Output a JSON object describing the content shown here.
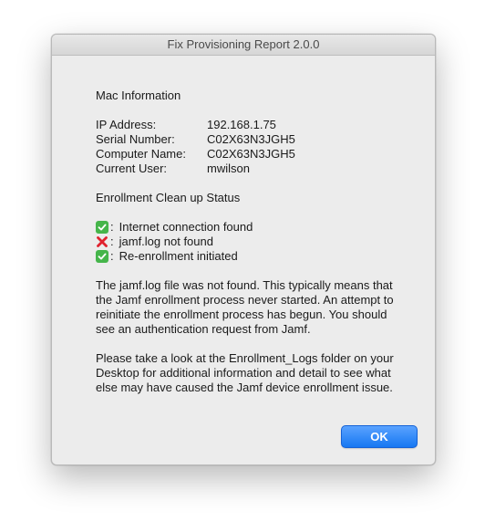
{
  "window": {
    "title": "Fix Provisioning Report 2.0.0"
  },
  "mac_info": {
    "heading": "Mac Information",
    "rows": [
      {
        "label": "IP Address:",
        "value": "192.168.1.75"
      },
      {
        "label": "Serial Number:",
        "value": "C02X63N3JGH5"
      },
      {
        "label": "Computer Name:",
        "value": "C02X63N3JGH5"
      },
      {
        "label": "Current User:",
        "value": "mwilson"
      }
    ]
  },
  "status": {
    "heading": "Enrollment Clean up Status",
    "items": [
      {
        "icon": "check-icon",
        "text": "Internet connection found"
      },
      {
        "icon": "cross-icon",
        "text": "jamf.log not found"
      },
      {
        "icon": "check-icon",
        "text": "Re-enrollment initiated"
      }
    ],
    "separator": ":"
  },
  "messages": {
    "p1": "The jamf.log file was not found. This typically means that the Jamf enrollment process never started. An attempt to reinitiate the enrollment process has begun. You should see an authentication request from Jamf.",
    "p2": "Please take a look at the Enrollment_Logs folder on your Desktop for additional information and detail to see what else may have caused the Jamf device enrollment issue."
  },
  "buttons": {
    "ok_label": "OK"
  },
  "colors": {
    "accent": "#1677f2",
    "success": "#45b54a",
    "error": "#e0222e"
  }
}
